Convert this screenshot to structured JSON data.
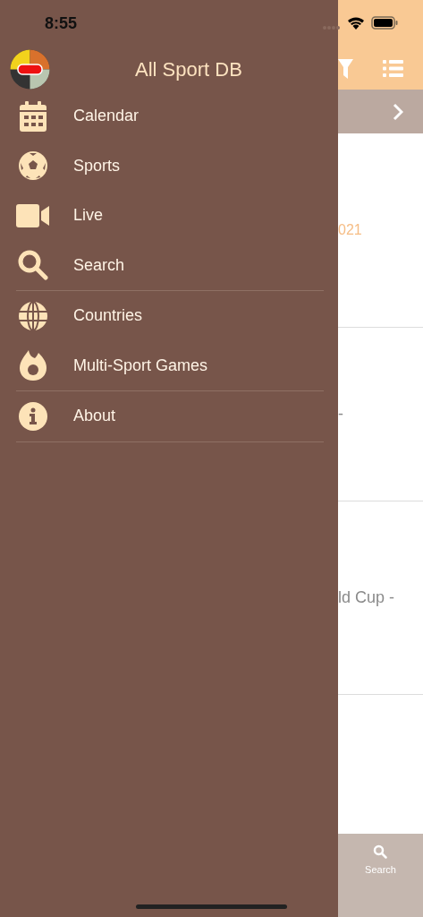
{
  "status_bar": {
    "time": "8:55"
  },
  "drawer": {
    "title": "All Sport DB",
    "groups": [
      {
        "items": [
          {
            "label": "Calendar",
            "kind": "calendar"
          },
          {
            "label": "Sports",
            "kind": "ball"
          },
          {
            "label": "Live",
            "kind": "video"
          },
          {
            "label": "Search",
            "kind": "search"
          }
        ]
      },
      {
        "items": [
          {
            "label": "Countries",
            "kind": "globe"
          },
          {
            "label": "Multi-Sport Games",
            "kind": "flame"
          }
        ]
      },
      {
        "items": [
          {
            "label": "About",
            "kind": "info"
          }
        ]
      }
    ]
  },
  "background": {
    "rows": [
      {
        "text": "021",
        "kind": "accent"
      },
      {
        "text": "-",
        "kind": "plain"
      },
      {
        "text": "ld Cup -",
        "kind": "plain"
      }
    ],
    "tab_bar": {
      "label": "Search"
    }
  }
}
